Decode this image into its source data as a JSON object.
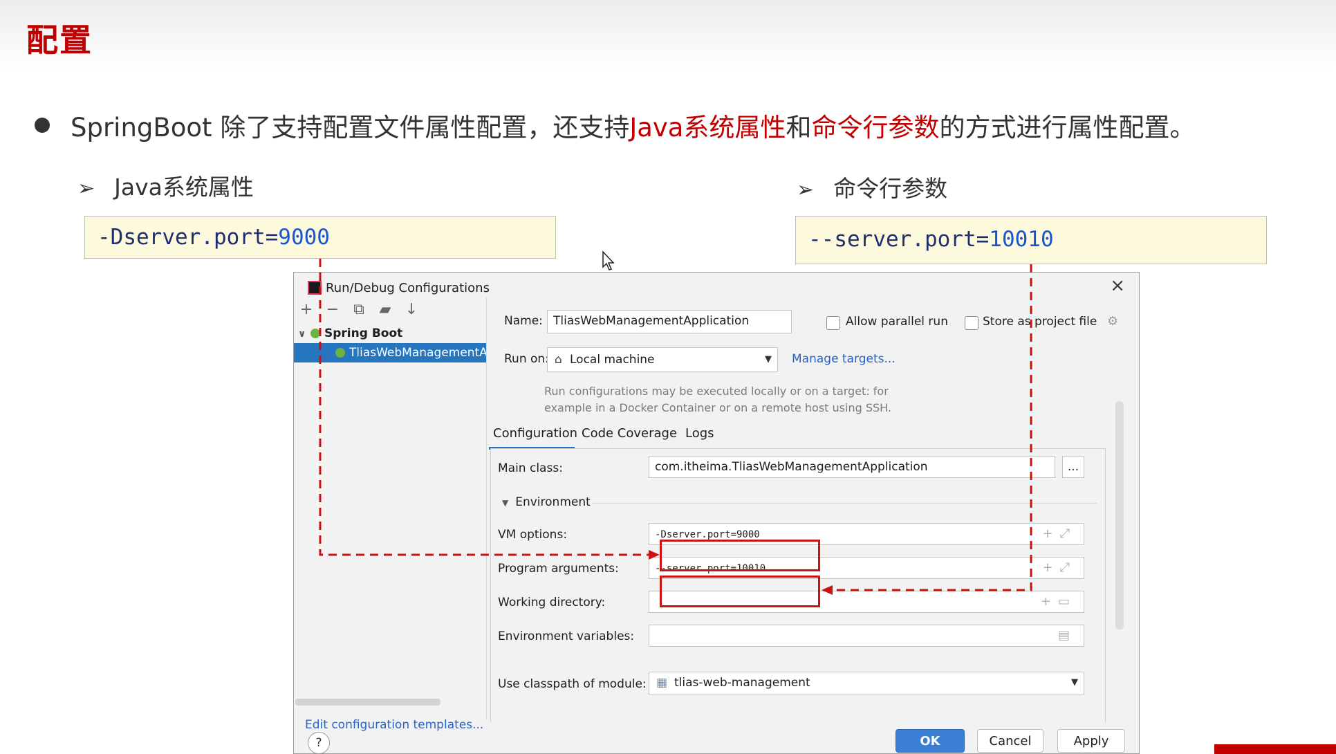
{
  "slide": {
    "title": "配置",
    "bullet": {
      "prefix": "SpringBoot 除了支持配置文件属性配置，还支持",
      "highlight1": "Java系统属性",
      "connector": "和",
      "highlight2": "命令行参数",
      "suffix": "的方式进行属性配置。"
    },
    "left_heading": "Java系统属性",
    "right_heading": "命令行参数",
    "left_code": {
      "text": "-Dserver.port=",
      "number": "9000"
    },
    "right_code": {
      "text": "--server.port=",
      "number": "10010"
    }
  },
  "dialog": {
    "title": "Run/Debug Configurations",
    "tree": {
      "group": "Spring Boot",
      "item": "TliasWebManagementA"
    },
    "edit_templates": "Edit configuration templates...",
    "name_label": "Name:",
    "name_value": "TliasWebManagementApplication",
    "allow_parallel": "Allow parallel run",
    "store_project": "Store as project file",
    "run_on_label": "Run on:",
    "run_on_value": "Local machine",
    "manage_targets": "Manage targets...",
    "hint_line1": "Run configurations may be executed locally or on a target: for",
    "hint_line2": "example in a Docker Container or on a remote host using SSH.",
    "tabs": [
      "Configuration",
      "Code Coverage",
      "Logs"
    ],
    "main_class_label": "Main class:",
    "main_class_value": "com.itheima.TliasWebManagementApplication",
    "more_button": "...",
    "environment_label": "Environment",
    "vm_options_label": "VM options:",
    "vm_options_value": "-Dserver.port=9000",
    "program_args_label": "Program arguments:",
    "program_args_value": "--server.port=10010",
    "working_dir_label": "Working directory:",
    "env_vars_label": "Environment variables:",
    "classpath_label": "Use classpath of module:",
    "classpath_value": "tlias-web-management",
    "ok": "OK",
    "cancel": "Cancel",
    "apply": "Apply",
    "help": "?"
  },
  "colors": {
    "highlight": "#c00000",
    "accent": "#2675bf",
    "arrow": "#cc1111"
  }
}
